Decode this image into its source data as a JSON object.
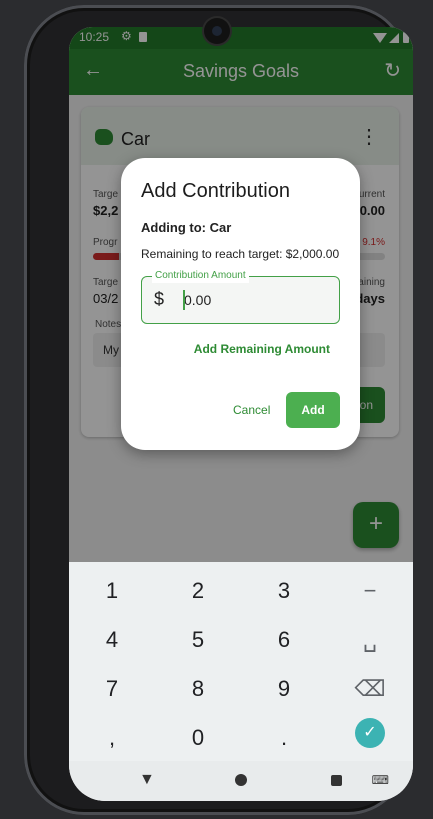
{
  "status_bar": {
    "time": "10:25"
  },
  "app_bar": {
    "title": "Savings Goals"
  },
  "goal_card": {
    "name": "Car",
    "target_label": "Targe",
    "target_value": "$2,2",
    "current_label": "urrent",
    "current_value": "0.00",
    "progress_label": "Progr",
    "progress_percent": "9.1%",
    "progress_fraction": 0.09,
    "target_date_label": "Targe",
    "target_date_value": "03/2",
    "remaining_label": "aining",
    "remaining_value": "days",
    "notes_label": "Notes",
    "notes_value": "My",
    "action_label": "on"
  },
  "dialog": {
    "title": "Add Contribution",
    "adding_to": "Adding to: Car",
    "remaining": "Remaining to reach target: $2,000.00",
    "field_label": "Contribution Amount",
    "field_prefix": "$",
    "field_value": "0.00",
    "add_remaining_label": "Add Remaining Amount",
    "cancel_label": "Cancel",
    "add_label": "Add"
  },
  "fab": {
    "label": "+"
  },
  "keyboard": {
    "rows": [
      [
        "1",
        "2",
        "3",
        "−"
      ],
      [
        "4",
        "5",
        "6",
        "␣"
      ],
      [
        "7",
        "8",
        "9",
        "⌫"
      ],
      [
        ",",
        "0",
        ".",
        "✓"
      ]
    ]
  },
  "icons": {
    "back": "arrow-left-icon",
    "refresh": "refresh-icon",
    "more": "more-vert-icon",
    "piggy": "piggy-bank-icon"
  },
  "colors": {
    "primary": "#2e8b34",
    "accent": "#4caf50",
    "error": "#d32f2f",
    "enter_key": "#3cb3b3"
  }
}
